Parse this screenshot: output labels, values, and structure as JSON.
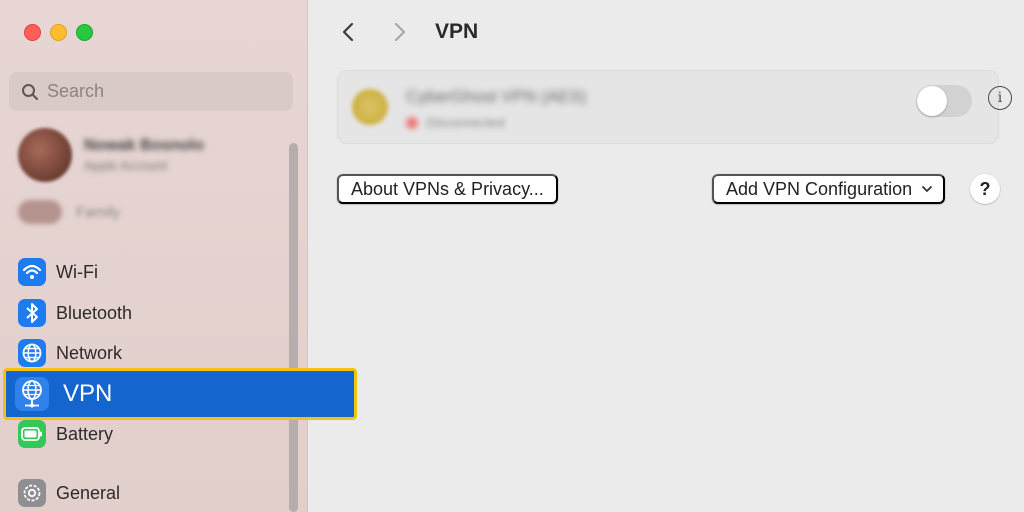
{
  "window": {
    "traffic_lights": [
      "close",
      "minimize",
      "zoom"
    ]
  },
  "sidebar": {
    "search_placeholder": "Search",
    "account": {
      "name": "Nowak Bosnolo",
      "subtitle": "Apple Account"
    },
    "family_label": "Family",
    "items": [
      {
        "label": "Wi-Fi",
        "icon": "wifi-icon",
        "color": "#1e7cf0"
      },
      {
        "label": "Bluetooth",
        "icon": "bluetooth-icon",
        "color": "#1e7cf0"
      },
      {
        "label": "Network",
        "icon": "globe-icon",
        "color": "#1e7cf0"
      },
      {
        "label": "VPN",
        "icon": "vpn-globe-icon",
        "color": "#2f82ec",
        "selected": true
      },
      {
        "label": "Battery",
        "icon": "battery-icon",
        "color": "#34c759"
      },
      {
        "label": "General",
        "icon": "gear-icon",
        "color": "#8e8e93"
      }
    ]
  },
  "main": {
    "title": "VPN",
    "vpn_entry": {
      "name": "CyberGhost VPN (AES)",
      "status": "Disconnected",
      "enabled": false
    },
    "about_button": "About VPNs & Privacy...",
    "add_button": "Add VPN Configuration",
    "help_label": "?",
    "info_label": "i"
  },
  "colors": {
    "selection": "#1565cf",
    "highlight_border": "#f4c20d",
    "accent": "#1e7cf0"
  }
}
